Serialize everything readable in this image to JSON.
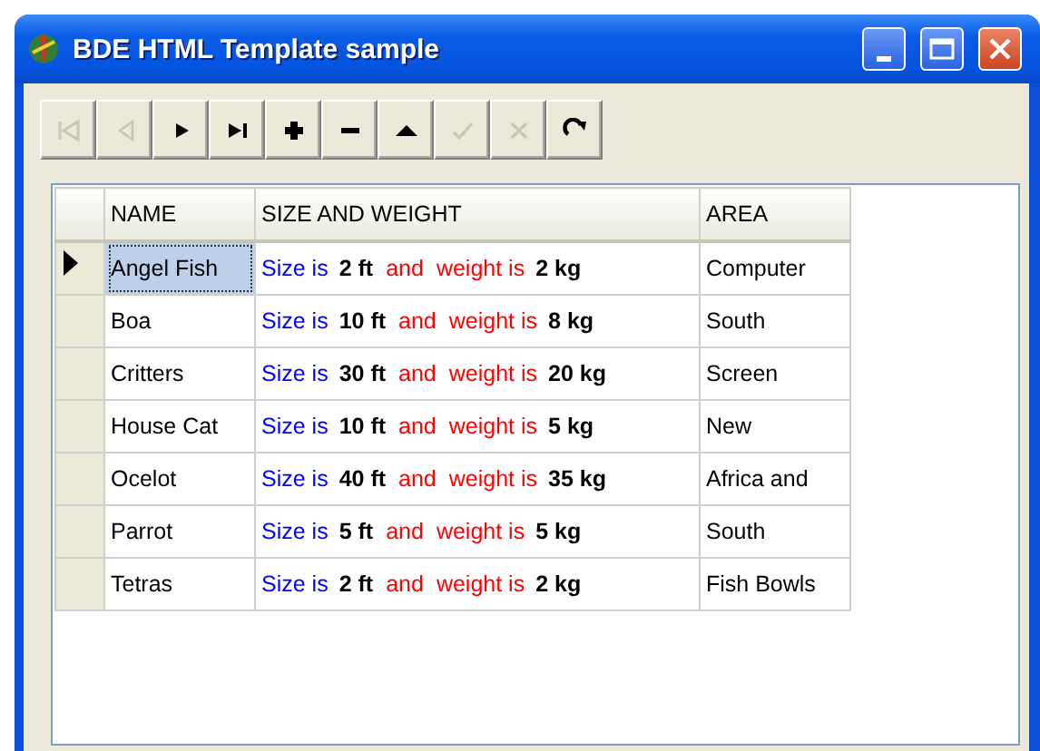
{
  "window": {
    "title": "BDE HTML Template sample"
  },
  "toolbar": [
    {
      "kind": "first",
      "disabled": true
    },
    {
      "kind": "prior",
      "disabled": true
    },
    {
      "kind": "next",
      "disabled": false
    },
    {
      "kind": "last",
      "disabled": false
    },
    {
      "kind": "insert",
      "disabled": false
    },
    {
      "kind": "delete",
      "disabled": false
    },
    {
      "kind": "edit",
      "disabled": false
    },
    {
      "kind": "post",
      "disabled": true
    },
    {
      "kind": "cancel",
      "disabled": true
    },
    {
      "kind": "refresh",
      "disabled": false
    }
  ],
  "table": {
    "columns": [
      "NAME",
      "SIZE AND WEIGHT",
      "AREA"
    ],
    "rows": [
      {
        "selected": true,
        "name": "Angel Fish",
        "size_label": "Size is",
        "size": "2 ft",
        "joiner": "and",
        "weight_label": "weight is",
        "weight": "2 kg",
        "area": "Computer"
      },
      {
        "selected": false,
        "name": "Boa",
        "size_label": "Size is",
        "size": "10 ft",
        "joiner": "and",
        "weight_label": "weight is",
        "weight": "8 kg",
        "area": "South"
      },
      {
        "selected": false,
        "name": "Critters",
        "size_label": "Size is",
        "size": "30 ft",
        "joiner": "and",
        "weight_label": "weight is",
        "weight": "20 kg",
        "area": "Screen"
      },
      {
        "selected": false,
        "name": "House Cat",
        "size_label": "Size is",
        "size": "10 ft",
        "joiner": "and",
        "weight_label": "weight is",
        "weight": "5 kg",
        "area": "New"
      },
      {
        "selected": false,
        "name": "Ocelot",
        "size_label": "Size is",
        "size": "40 ft",
        "joiner": "and",
        "weight_label": "weight is",
        "weight": "35 kg",
        "area": "Africa and"
      },
      {
        "selected": false,
        "name": "Parrot",
        "size_label": "Size is",
        "size": "5 ft",
        "joiner": "and",
        "weight_label": "weight is",
        "weight": "5 kg",
        "area": "South"
      },
      {
        "selected": false,
        "name": "Tetras",
        "size_label": "Size is",
        "size": "2 ft",
        "joiner": "and",
        "weight_label": "weight is",
        "weight": "2 kg",
        "area": "Fish Bowls"
      }
    ]
  }
}
